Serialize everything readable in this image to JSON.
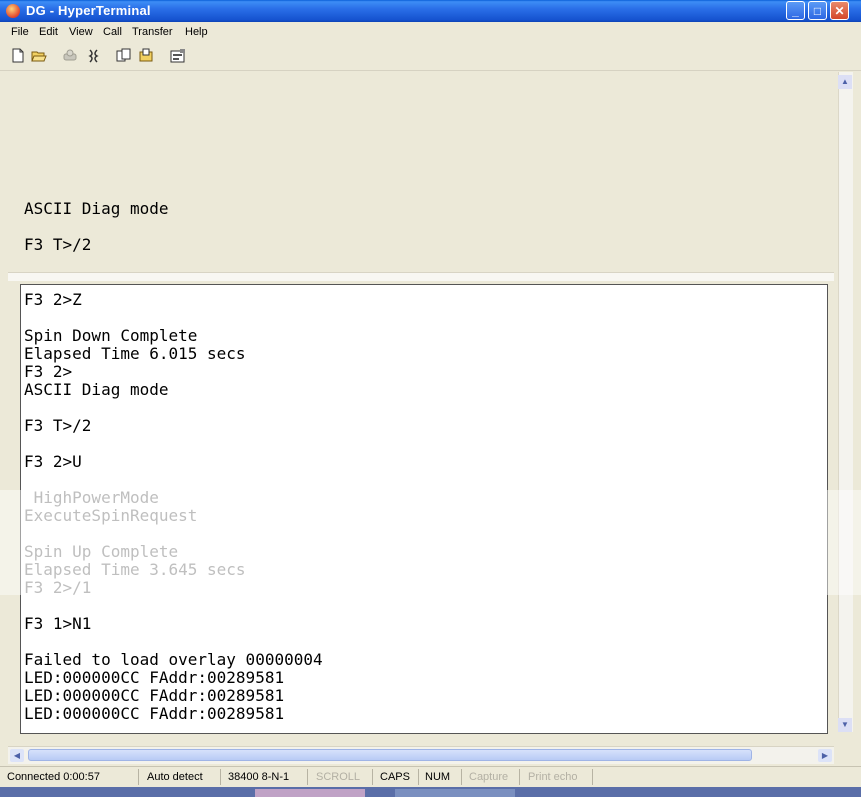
{
  "window": {
    "title": "DG - HyperTerminal",
    "controls": {
      "minimize": "_",
      "maximize": "□",
      "close": "✕"
    }
  },
  "menu": [
    "File",
    "Edit",
    "View",
    "Call",
    "Transfer",
    "Help"
  ],
  "toolbar": {
    "icons": [
      "new-icon",
      "open-icon",
      "connect-icon",
      "disconnect-icon",
      "send-icon",
      "receive-icon",
      "properties-icon"
    ]
  },
  "terminal": {
    "upper_lines": [
      "ASCII Diag mode",
      "F3 T>/2"
    ],
    "lower_lines": [
      {
        "text": "F3 2>Z",
        "faded": false
      },
      {
        "text": "",
        "faded": false
      },
      {
        "text": "Spin Down Complete",
        "faded": false
      },
      {
        "text": "Elapsed Time 6.015 secs",
        "faded": false
      },
      {
        "text": "F3 2>",
        "faded": false
      },
      {
        "text": "ASCII Diag mode",
        "faded": false
      },
      {
        "text": "",
        "faded": false
      },
      {
        "text": "F3 T>/2",
        "faded": false
      },
      {
        "text": "",
        "faded": false
      },
      {
        "text": "F3 2>U",
        "faded": false
      },
      {
        "text": "",
        "faded": false
      },
      {
        "text": " HighPowerMode",
        "faded": true
      },
      {
        "text": "ExecuteSpinRequest",
        "faded": true
      },
      {
        "text": "",
        "faded": false
      },
      {
        "text": "Spin Up Complete",
        "faded": true
      },
      {
        "text": "Elapsed Time 3.645 secs",
        "faded": true
      },
      {
        "text": "F3 2>/1",
        "faded": true
      },
      {
        "text": "",
        "faded": false
      },
      {
        "text": "F3 1>N1",
        "faded": false
      },
      {
        "text": "",
        "faded": false
      },
      {
        "text": "Failed to load overlay 00000004",
        "faded": false
      },
      {
        "text": "LED:000000CC FAddr:00289581",
        "faded": false
      },
      {
        "text": "LED:000000CC FAddr:00289581",
        "faded": false
      },
      {
        "text": "LED:000000CC FAddr:00289581",
        "faded": false
      }
    ]
  },
  "statusbar": {
    "connected": "Connected 0:00:57",
    "detect": "Auto detect",
    "settings": "38400 8-N-1",
    "scroll": "SCROLL",
    "caps": "CAPS",
    "num": "NUM",
    "capture": "Capture",
    "print_echo": "Print echo"
  }
}
